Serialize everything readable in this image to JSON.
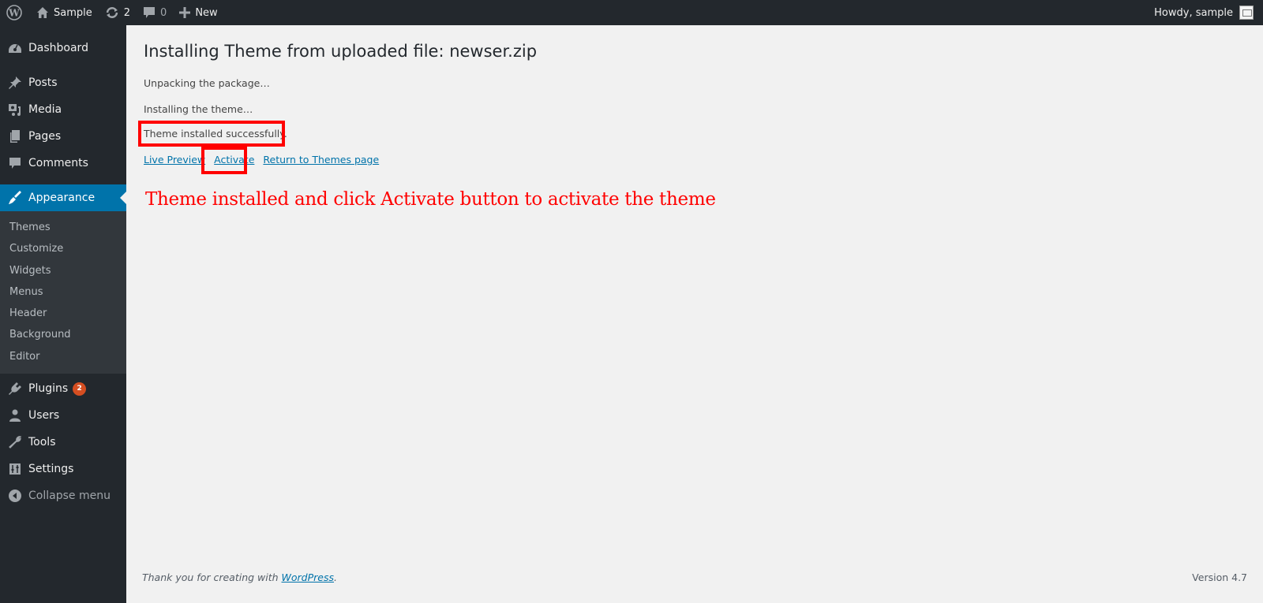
{
  "adminbar": {
    "site_name": "Sample",
    "updates_count": "2",
    "comments_count": "0",
    "new_label": "New",
    "greeting": "Howdy, sample"
  },
  "sidebar": {
    "items": [
      {
        "label": "Dashboard",
        "icon": "dashboard-icon"
      },
      {
        "label": "Posts",
        "icon": "pin-icon"
      },
      {
        "label": "Media",
        "icon": "media-icon"
      },
      {
        "label": "Pages",
        "icon": "pages-icon"
      },
      {
        "label": "Comments",
        "icon": "comment-icon"
      },
      {
        "label": "Appearance",
        "icon": "paintbrush-icon",
        "active": true
      }
    ],
    "submenu": [
      "Themes",
      "Customize",
      "Widgets",
      "Menus",
      "Header",
      "Background",
      "Editor"
    ],
    "items_after": [
      {
        "label": "Plugins",
        "icon": "plugin-icon",
        "badge": "2"
      },
      {
        "label": "Users",
        "icon": "user-icon"
      },
      {
        "label": "Tools",
        "icon": "wrench-icon"
      },
      {
        "label": "Settings",
        "icon": "settings-icon"
      }
    ],
    "collapse_label": "Collapse menu"
  },
  "main": {
    "title": "Installing Theme from uploaded file: newser.zip",
    "steps": [
      "Unpacking the package…",
      "Installing the theme…",
      "Theme installed successfully."
    ],
    "actions": {
      "live_preview": "Live Preview",
      "activate": "Activate",
      "return": "Return to Themes page"
    },
    "annotation": "Theme installed and click Activate button to activate the theme",
    "highlight_color": "#ff0000"
  },
  "footer": {
    "thanks_prefix": "Thank you for creating with ",
    "wordpress_link": "WordPress",
    "thanks_suffix": ".",
    "version": "Version 4.7"
  }
}
